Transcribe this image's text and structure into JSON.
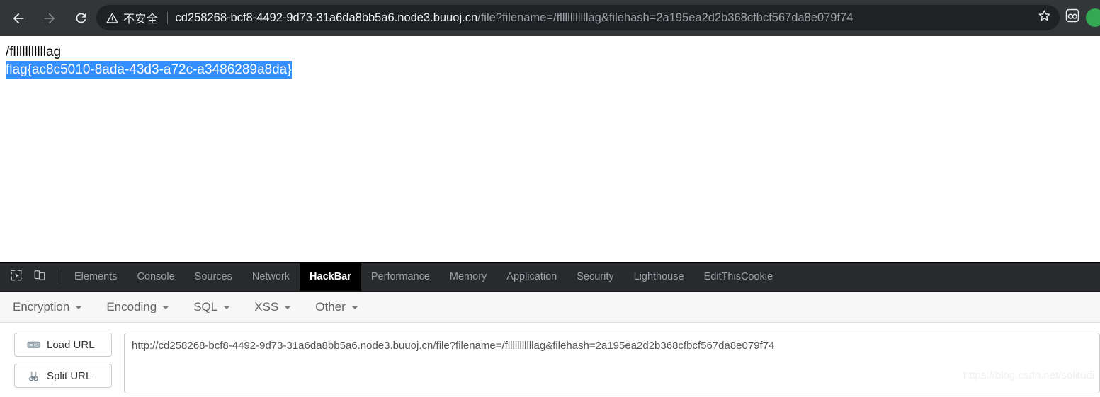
{
  "browser": {
    "back_icon": "back-arrow-icon",
    "forward_icon": "forward-arrow-icon",
    "reload_icon": "reload-icon",
    "security_warning_icon": "warning-triangle-icon",
    "security_label": "不安全",
    "url_host": "cd258268-bcf8-4492-9d73-31a6da8bb5a6.node3.buuoj.cn",
    "url_path": "/file?filename=/flllllllllllag&filehash=2a195ea2d2b368cfbcf567da8e079f74",
    "bookmark_icon": "star-icon",
    "extension_icon": "hackbar-extension-icon",
    "profile_icon": "profile-avatar-icon",
    "colors": {
      "chrome_bg": "#323639",
      "omnibox_bg": "#202124",
      "url_host_color": "#f1f3f4",
      "url_path_color": "#9aa0a6",
      "profile_green": "#34a853"
    }
  },
  "page": {
    "line1": "/flllllllllllag",
    "line2": "flag{ac8c5010-8ada-43d3-a72c-a3486289a8da}",
    "selection_bg": "#338fff",
    "selection_fg": "#ffffff"
  },
  "devtools": {
    "inspect_icon": "inspect-element-icon",
    "device_toolbar_icon": "device-toolbar-icon",
    "tabs": [
      {
        "label": "Elements",
        "active": false
      },
      {
        "label": "Console",
        "active": false
      },
      {
        "label": "Sources",
        "active": false
      },
      {
        "label": "Network",
        "active": false
      },
      {
        "label": "HackBar",
        "active": true
      },
      {
        "label": "Performance",
        "active": false
      },
      {
        "label": "Memory",
        "active": false
      },
      {
        "label": "Application",
        "active": false
      },
      {
        "label": "Security",
        "active": false
      },
      {
        "label": "Lighthouse",
        "active": false
      },
      {
        "label": "EditThisCookie",
        "active": false
      }
    ]
  },
  "hackbar": {
    "menus": [
      {
        "label": "Encryption"
      },
      {
        "label": "Encoding"
      },
      {
        "label": "SQL"
      },
      {
        "label": "XSS"
      },
      {
        "label": "Other"
      }
    ],
    "load_url_label": "Load URL",
    "load_url_icon": "disk-drive-icon",
    "split_url_label": "Split URL",
    "split_url_icon": "scissors-icon",
    "url_value": "http://cd258268-bcf8-4492-9d73-31a6da8bb5a6.node3.buuoj.cn/file?filename=/flllllllllllag&filehash=2a195ea2d2b368cfbcf567da8e079f74",
    "url_placeholder": "URL"
  },
  "watermark": {
    "text": "https://blog.csdn.net/solitudi"
  }
}
